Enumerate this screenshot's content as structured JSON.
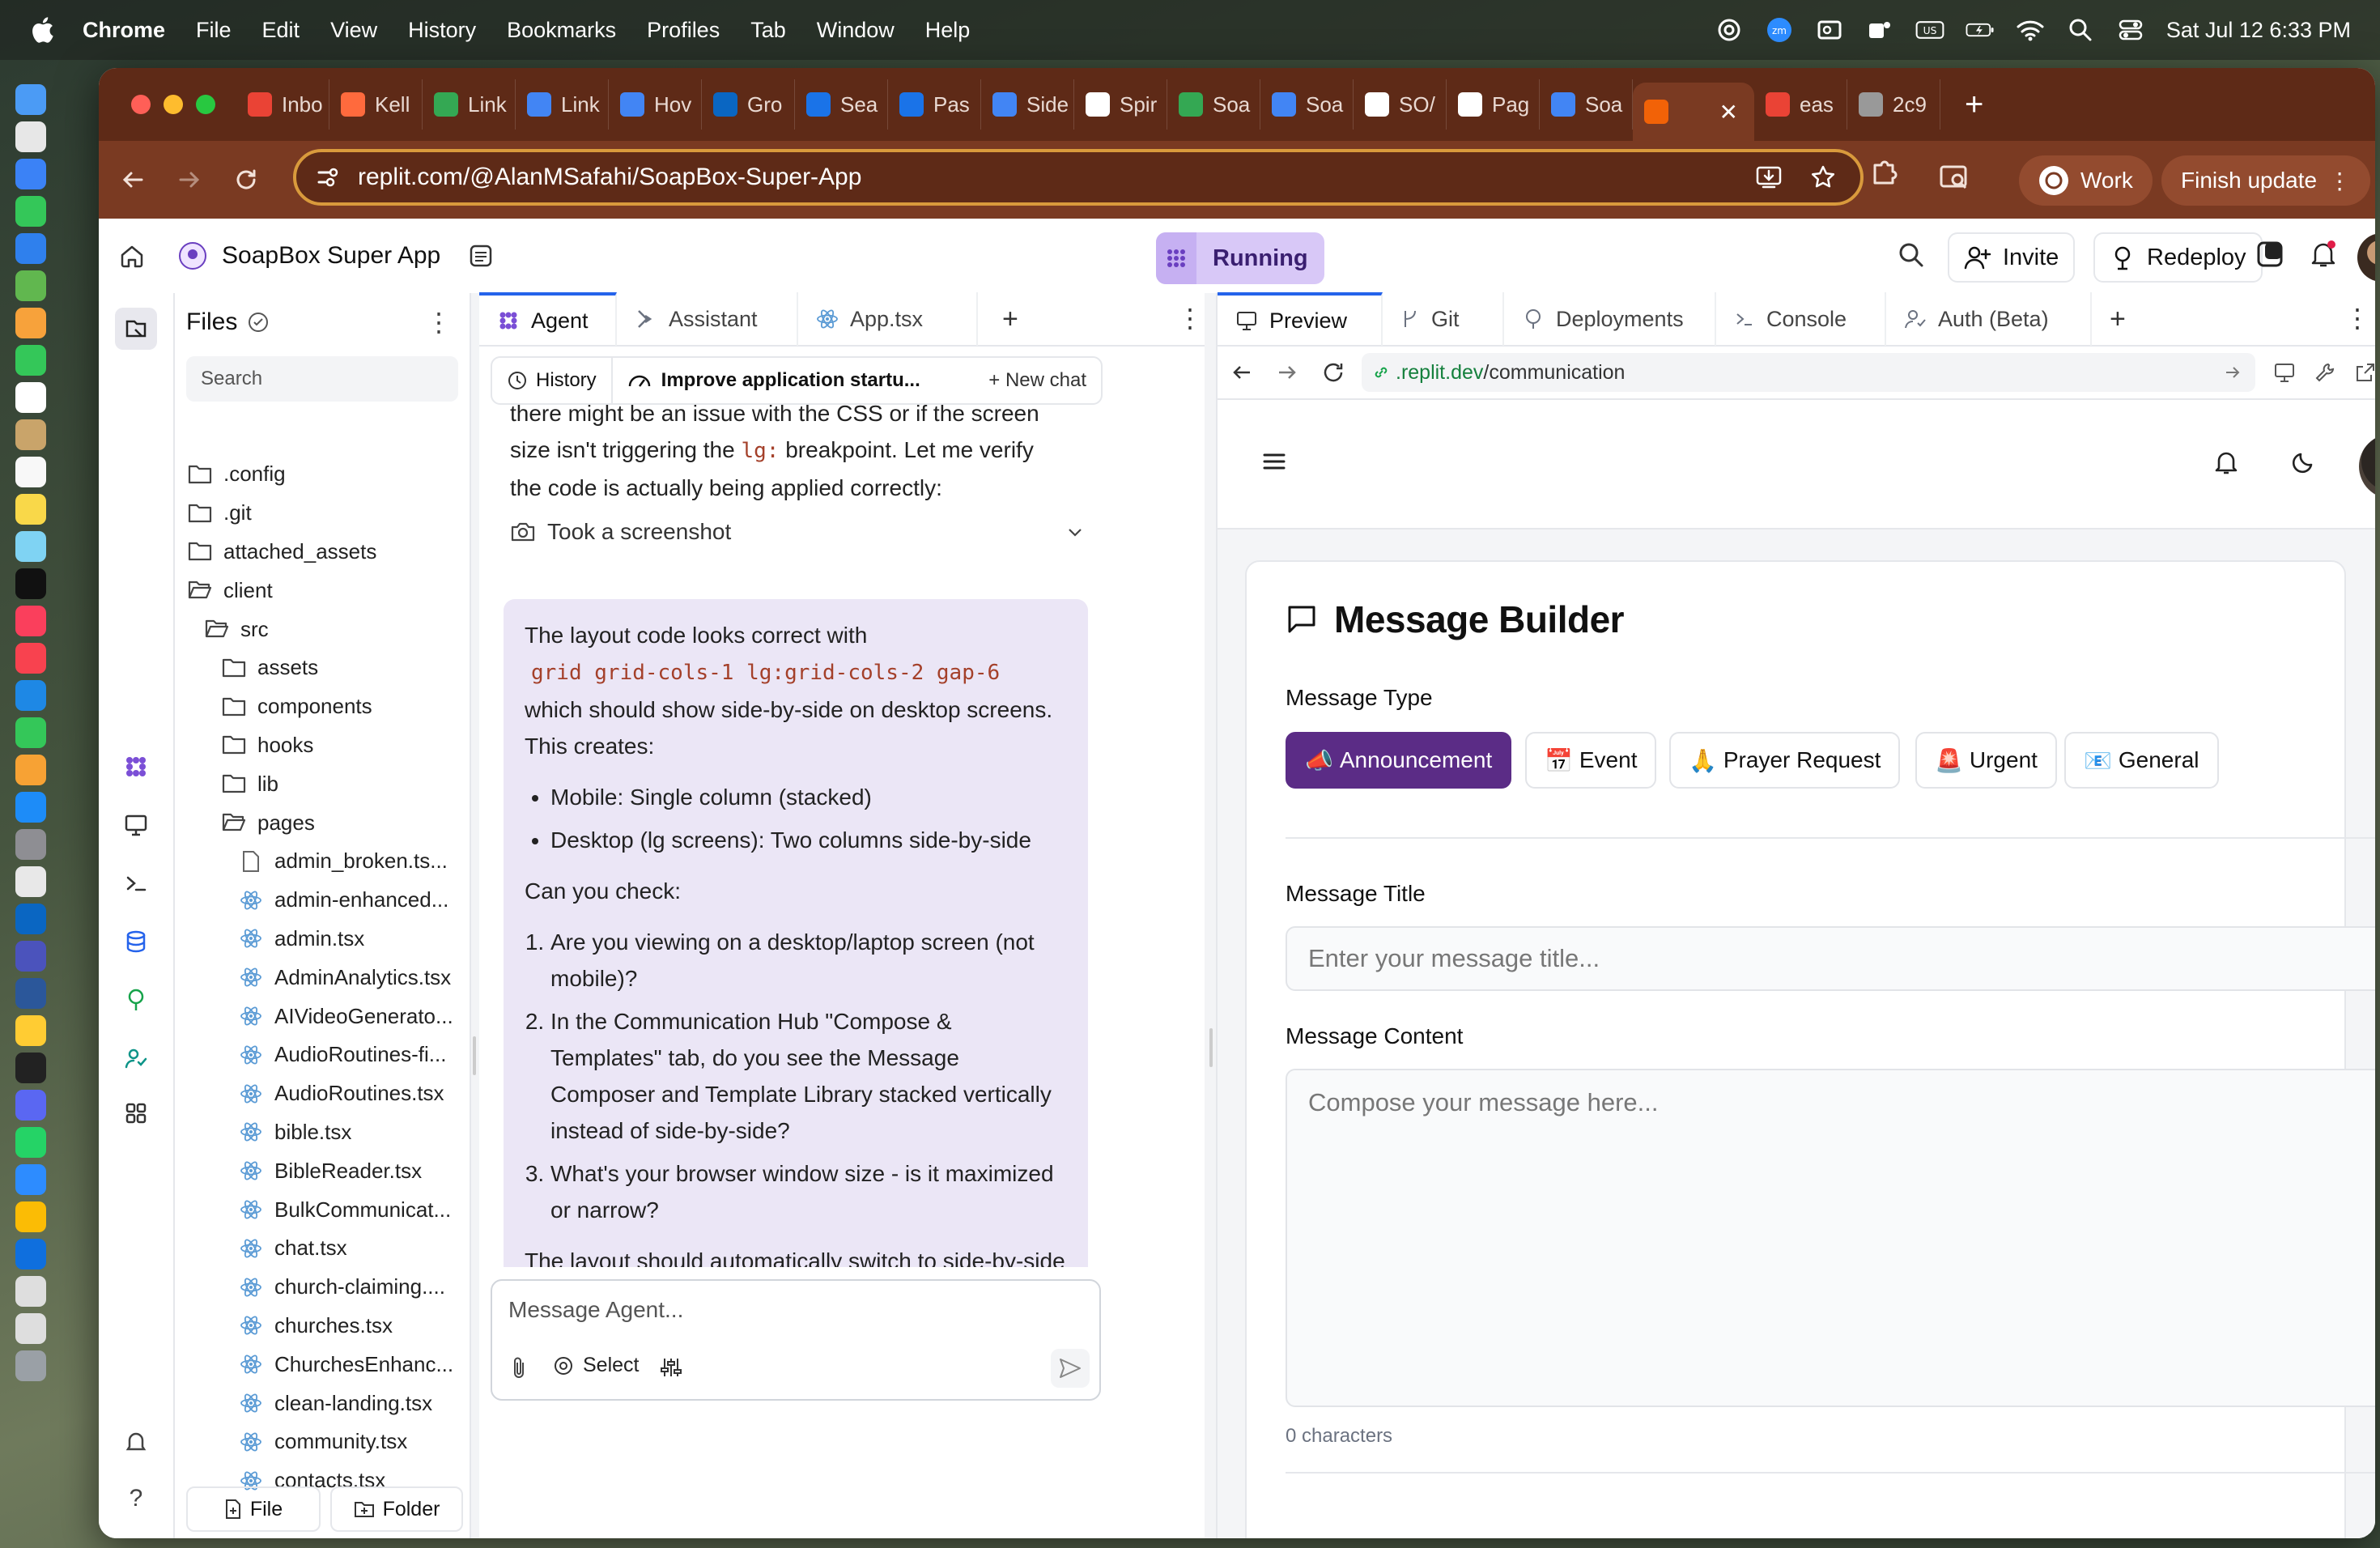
{
  "menubar": {
    "app": "Chrome",
    "items": [
      "File",
      "Edit",
      "View",
      "History",
      "Bookmarks",
      "Profiles",
      "Tab",
      "Window",
      "Help"
    ],
    "keyboard": "US",
    "datetime": "Sat Jul 12  6:33 PM"
  },
  "browser": {
    "tabs": [
      {
        "label": "Inbo",
        "color": "#ea4335"
      },
      {
        "label": "Kell",
        "color": "#ff6a3d"
      },
      {
        "label": "Link",
        "color": "#34a853"
      },
      {
        "label": "Link",
        "color": "#4285f4"
      },
      {
        "label": "Hov",
        "color": "#4285f4"
      },
      {
        "label": "Gro",
        "color": "#0a66c2"
      },
      {
        "label": "Sea",
        "color": "#1a73e8"
      },
      {
        "label": "Pas",
        "color": "#1a73e8"
      },
      {
        "label": "Side",
        "color": "#4285f4"
      },
      {
        "label": "Spir",
        "color": "#ffffff"
      },
      {
        "label": "Soa",
        "color": "#34a853"
      },
      {
        "label": "Soa",
        "color": "#4285f4"
      },
      {
        "label": "SO/",
        "color": "#ffffff"
      },
      {
        "label": "Pag",
        "color": "#ffffff"
      },
      {
        "label": "Soa",
        "color": "#4285f4"
      }
    ],
    "after_tabs": [
      {
        "label": "eas",
        "color": "#ea4335"
      },
      {
        "label": "2c9",
        "color": "#999999"
      }
    ],
    "url": "replit.com/@AlanMSafahi/SoapBox-Super-App",
    "profile": "Work",
    "update": "Finish update"
  },
  "replit": {
    "project": "SoapBox Super App",
    "status": "Running",
    "invite": "Invite",
    "redeploy": "Redeploy",
    "files": {
      "title": "Files",
      "search": "Search",
      "tree": [
        {
          "name": ".config",
          "type": "folder",
          "level": 0
        },
        {
          "name": ".git",
          "type": "folder",
          "level": 0
        },
        {
          "name": "attached_assets",
          "type": "folder",
          "level": 0
        },
        {
          "name": "client",
          "type": "folder-open",
          "level": 0
        },
        {
          "name": "src",
          "type": "folder-open",
          "level": 1
        },
        {
          "name": "assets",
          "type": "folder",
          "level": 2
        },
        {
          "name": "components",
          "type": "folder",
          "level": 2
        },
        {
          "name": "hooks",
          "type": "folder",
          "level": 2
        },
        {
          "name": "lib",
          "type": "folder",
          "level": 2
        },
        {
          "name": "pages",
          "type": "folder-open",
          "level": 2
        },
        {
          "name": "admin_broken.ts...",
          "type": "file",
          "level": 3
        },
        {
          "name": "admin-enhanced...",
          "type": "react",
          "level": 3
        },
        {
          "name": "admin.tsx",
          "type": "react",
          "level": 3
        },
        {
          "name": "AdminAnalytics.tsx",
          "type": "react",
          "level": 3
        },
        {
          "name": "AIVideoGenerato...",
          "type": "react",
          "level": 3
        },
        {
          "name": "AudioRoutines-fi...",
          "type": "react",
          "level": 3
        },
        {
          "name": "AudioRoutines.tsx",
          "type": "react",
          "level": 3
        },
        {
          "name": "bible.tsx",
          "type": "react",
          "level": 3
        },
        {
          "name": "BibleReader.tsx",
          "type": "react",
          "level": 3
        },
        {
          "name": "BulkCommunicat...",
          "type": "react",
          "level": 3
        },
        {
          "name": "chat.tsx",
          "type": "react",
          "level": 3
        },
        {
          "name": "church-claiming....",
          "type": "react",
          "level": 3
        },
        {
          "name": "churches.tsx",
          "type": "react",
          "level": 3
        },
        {
          "name": "ChurchesEnhanc...",
          "type": "react",
          "level": 3
        },
        {
          "name": "clean-landing.tsx",
          "type": "react",
          "level": 3
        },
        {
          "name": "community.tsx",
          "type": "react",
          "level": 3
        },
        {
          "name": "contacts.tsx",
          "type": "react",
          "level": 3
        }
      ],
      "new_file": "File",
      "new_folder": "Folder"
    },
    "agent": {
      "tabs": [
        "Agent",
        "Assistant",
        "App.tsx"
      ],
      "history": "History",
      "chat_title": "Improve application startu...",
      "new_chat": "New chat",
      "intro_line1": "there might be an issue with the CSS or if the screen",
      "intro_line2a": "size isn't triggering the",
      "intro_code": "lg:",
      "intro_line2b": "breakpoint. Let me verify",
      "intro_line3": "the code is actually being applied correctly:",
      "screenshot": "Took a screenshot",
      "bubble": {
        "p1": "The layout code looks correct with",
        "code": "grid grid-cols-1 lg:grid-cols-2 gap-6",
        "p2a": "which should show side-by-side on desktop screens.",
        "p2b": "This creates:",
        "bullets": [
          "Mobile: Single column (stacked)",
          "Desktop (lg screens): Two columns side-by-side"
        ],
        "ask": "Can you check:",
        "q1": "Are you viewing on a desktop/laptop screen (not mobile)?",
        "q2": "In the Communication Hub \"Compose & Templates\" tab, do you see the Message Composer and Template Library stacked vertically instead of side-by-side?",
        "q3": "What's your browser window size - is it maximized or narrow?",
        "closing": "The layout should automatically switch to side-by-side once the screen is wide enough. If it's still not working, I can adjust the breakpoint."
      },
      "composer_placeholder": "Message Agent...",
      "select": "Select"
    },
    "preview": {
      "tabs": [
        "Preview",
        "Git",
        "Deployments",
        "Console",
        "Auth (Beta)"
      ],
      "url_domain": ".replit.dev",
      "url_path": "/communication",
      "app": {
        "title": "Message Builder",
        "type_label": "Message Type",
        "types": [
          {
            "emoji": "📣",
            "label": "Announcement"
          },
          {
            "emoji": "📅",
            "label": "Event"
          },
          {
            "emoji": "🙏",
            "label": "Prayer Request"
          },
          {
            "emoji": "🚨",
            "label": "Urgent"
          },
          {
            "emoji": "📧",
            "label": "General"
          }
        ],
        "title_label": "Message Title",
        "title_placeholder": "Enter your message title...",
        "content_label": "Message Content",
        "content_placeholder": "Compose your message here...",
        "char_count": "0 characters"
      }
    }
  }
}
